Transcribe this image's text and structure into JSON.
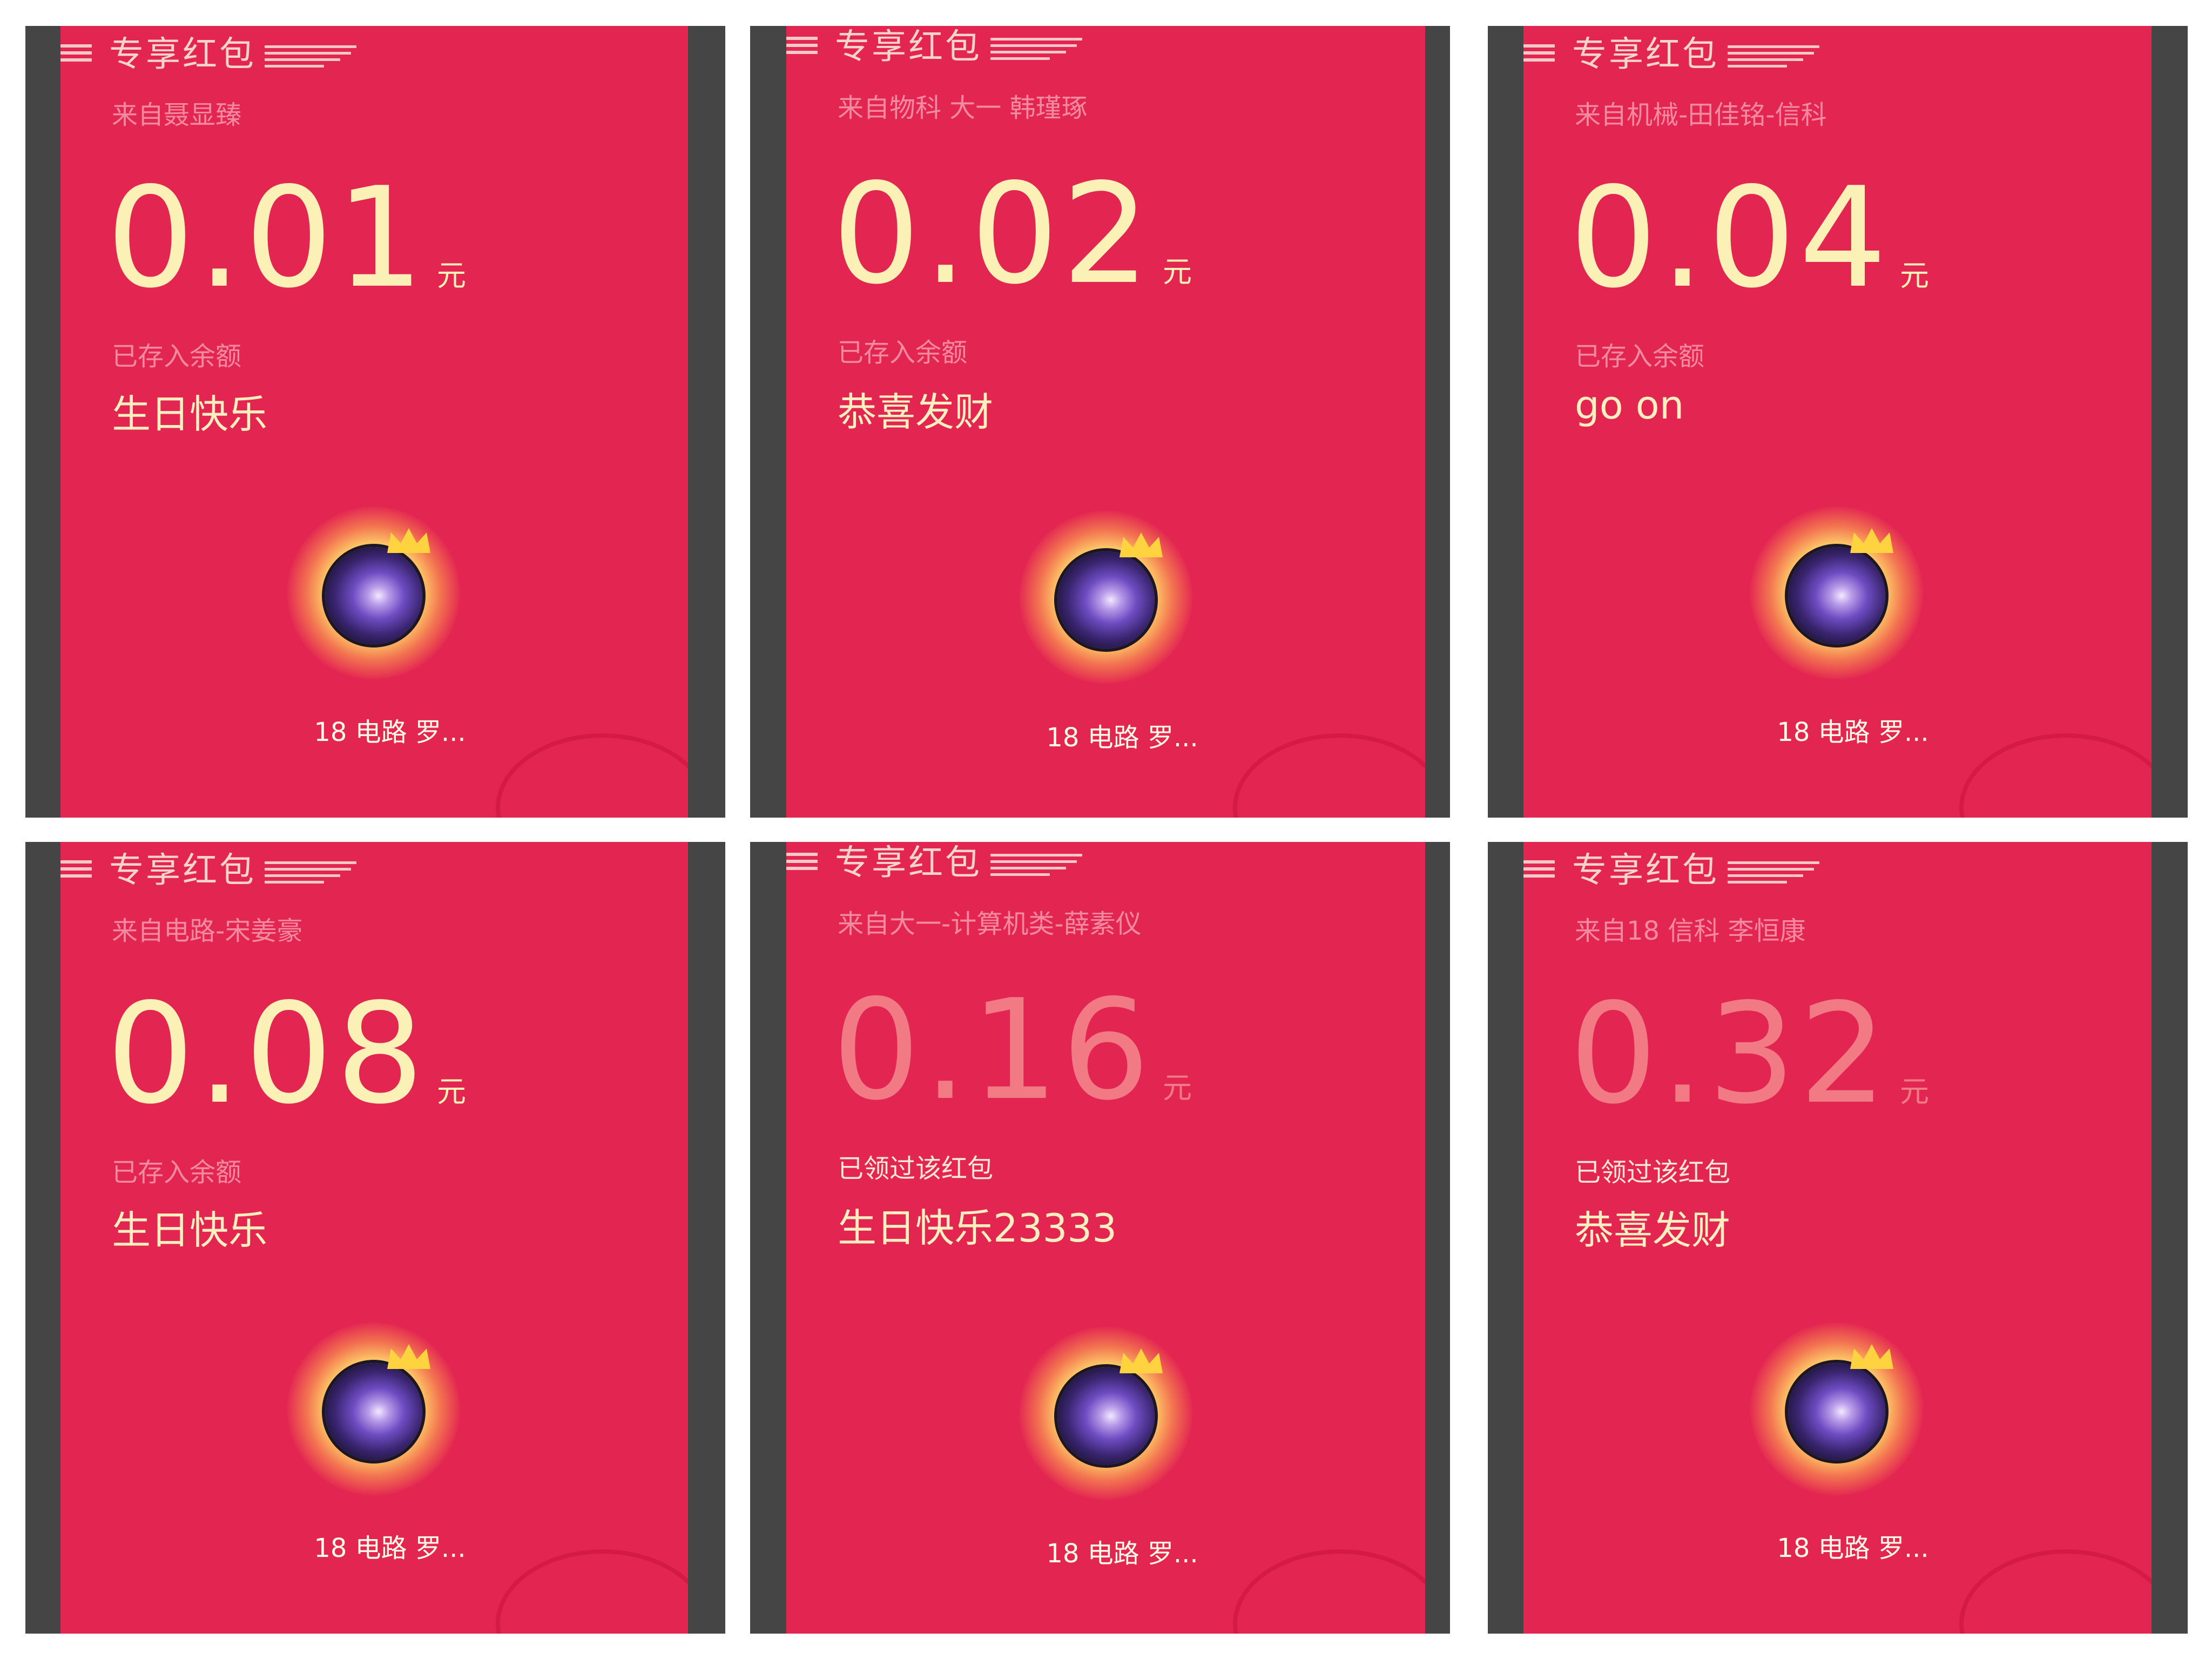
{
  "header_title": "专享红包",
  "unit": "元",
  "cards": [
    {
      "from": "来自聂显臻",
      "amount": "0.01",
      "status": "已存入余额",
      "message": "生日快乐",
      "avatar_name": "18 电路 罗...",
      "claimed": false
    },
    {
      "from": "来自物科  大一  韩瑾琢",
      "amount": "0.02",
      "status": "已存入余额",
      "message": "恭喜发财",
      "avatar_name": "18 电路 罗...",
      "claimed": false
    },
    {
      "from": "来自机械-田佳铭-信科",
      "amount": "0.04",
      "status": "已存入余额",
      "message": "go on",
      "avatar_name": "18 电路 罗...",
      "claimed": false
    },
    {
      "from": "来自电路-宋姜豪",
      "amount": "0.08",
      "status": "已存入余额",
      "message": "生日快乐",
      "avatar_name": "18 电路 罗...",
      "claimed": false
    },
    {
      "from": "来自大一-计算机类-薛素仪",
      "amount": "0.16",
      "status": "已领过该红包",
      "message": "生日快乐23333",
      "avatar_name": "18 电路 罗...",
      "claimed": true
    },
    {
      "from": "来自18 信科 李恒康",
      "amount": "0.32",
      "status": "已领过该红包",
      "message": "恭喜发财",
      "avatar_name": "18 电路 罗...",
      "claimed": true
    }
  ],
  "colors": {
    "sheet_red": "#e32551",
    "amount_gold": "#fbf0b5",
    "amount_claimed": "#f27a85",
    "side_gray": "#454545"
  },
  "icons": {
    "avatar": "galaxy-orb-avatar-icon",
    "crown": "crown-icon",
    "header_lines": "header-lines-icon"
  }
}
